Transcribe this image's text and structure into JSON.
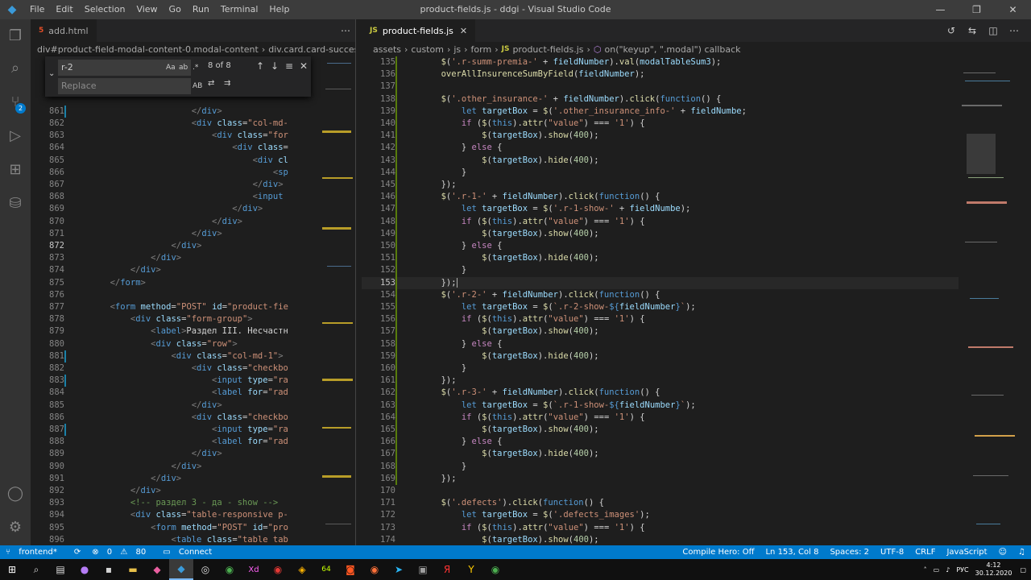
{
  "app": {
    "menus": [
      "File",
      "Edit",
      "Selection",
      "View",
      "Go",
      "Run",
      "Terminal",
      "Help"
    ],
    "title": "product-fields.js - ddgi - Visual Studio Code"
  },
  "activity": {
    "scm_badge": "2"
  },
  "left": {
    "tab": "add.html",
    "breadcrumb": [
      "div#product-field-modal-content-0.modal-content",
      "div.card.card-success"
    ],
    "find": {
      "value": "r-2",
      "replace_placeholder": "Replace",
      "count": "8 of 8",
      "case": "Aa",
      "word": "ab",
      "regex": ".*",
      "preserve": "AB"
    }
  },
  "right": {
    "tab": "product-fields.js",
    "breadcrumb": [
      "assets",
      "custom",
      "js",
      "form",
      "product-fields.js",
      "on(\"keyup\", \".modal\") callback"
    ]
  },
  "status": {
    "branch": "frontend*",
    "errors": "0",
    "warnings": "80",
    "connect": "Connect",
    "compile": "Compile Hero: Off",
    "position": "Ln 153, Col 8",
    "spaces": "Spaces: 2",
    "encoding": "UTF-8",
    "eol": "CRLF",
    "language": "JavaScript"
  },
  "taskbar": {
    "time": "4:12",
    "date": "30.12.2020",
    "lang": "РУС"
  }
}
